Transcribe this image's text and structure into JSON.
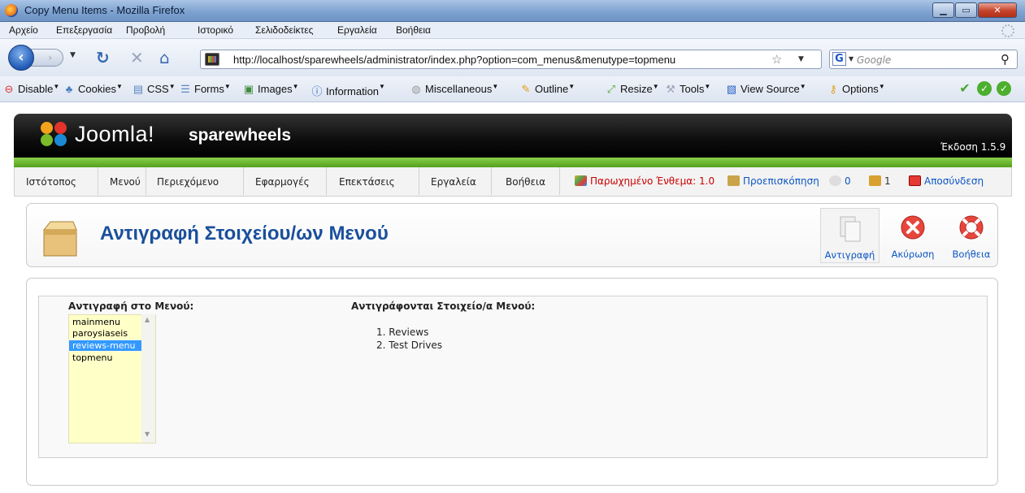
{
  "window": {
    "title": "Copy Menu Items - Mozilla Firefox"
  },
  "menubar": {
    "items": [
      "Αρχείο",
      "Επεξεργασία",
      "Προβολή",
      "Ιστορικό",
      "Σελιδοδείκτες",
      "Εργαλεία",
      "Βοήθεια"
    ]
  },
  "navbar": {
    "url": "http://localhost/sparewheels/administrator/index.php?option=com_menus&menutype=topmenu",
    "search_placeholder": "Google"
  },
  "devtoolbar": {
    "items": [
      "Disable",
      "Cookies",
      "CSS",
      "Forms",
      "Images",
      "Information",
      "Miscellaneous",
      "Outline",
      "Resize",
      "Tools",
      "View Source",
      "Options"
    ]
  },
  "joomla": {
    "brand": "Joomla!",
    "site_name": "sparewheels",
    "version": "Έκδοση 1.5.9",
    "menu": [
      "Ιστότοπος",
      "Μενού",
      "Περιεχόμενο",
      "Εφαρμογές",
      "Επεκτάσεις",
      "Εργαλεία",
      "Βοήθεια"
    ],
    "status": {
      "legacy": "Παρωχημένο Ένθεμα: 1.0",
      "preview": "Προεπισκόπηση",
      "messages": "0",
      "users": "1",
      "logout": "Αποσύνδεση"
    },
    "page_title": "Αντιγραφή Στοιχείου/ων Μενού",
    "toolbar": {
      "copy": "Αντιγραφή",
      "cancel": "Ακύρωση",
      "help": "Βοήθεια"
    },
    "copy_to_label": "Αντιγραφή στο Μενού:",
    "menus": [
      "mainmenu",
      "paroysiaseis",
      "reviews-menu",
      "topmenu"
    ],
    "selected_menu": "reviews-menu",
    "items_label": "Αντιγράφονται Στοιχείο/α Μενού:",
    "items": [
      "1.  Reviews",
      "2.  Test Drives"
    ]
  },
  "colors": {
    "title_blue": "#1a4f9c",
    "link_blue": "#0b55c4",
    "joomla_green": "#6bb82e",
    "select_bg": "#ffffc8",
    "selected_option": "#3399ff"
  }
}
